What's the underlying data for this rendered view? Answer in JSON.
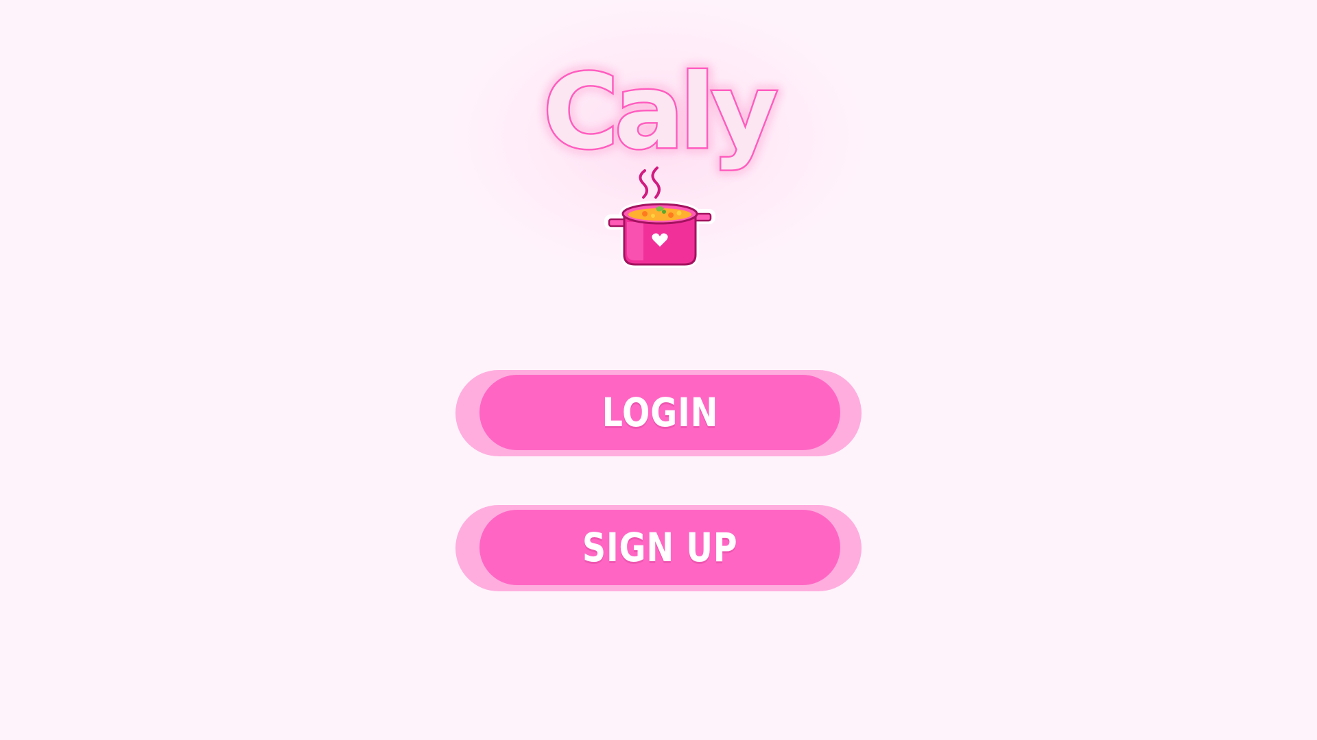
{
  "app": {
    "name": "Caly",
    "logo_icon": "cooking-pot-icon"
  },
  "actions": {
    "login_label": "LOGIN",
    "signup_label": "SIGN UP"
  },
  "colors": {
    "background": "#fff3fb",
    "button_outer": "#ffaddf",
    "button_inner": "#ff66c4",
    "accent": "#f2309a"
  }
}
